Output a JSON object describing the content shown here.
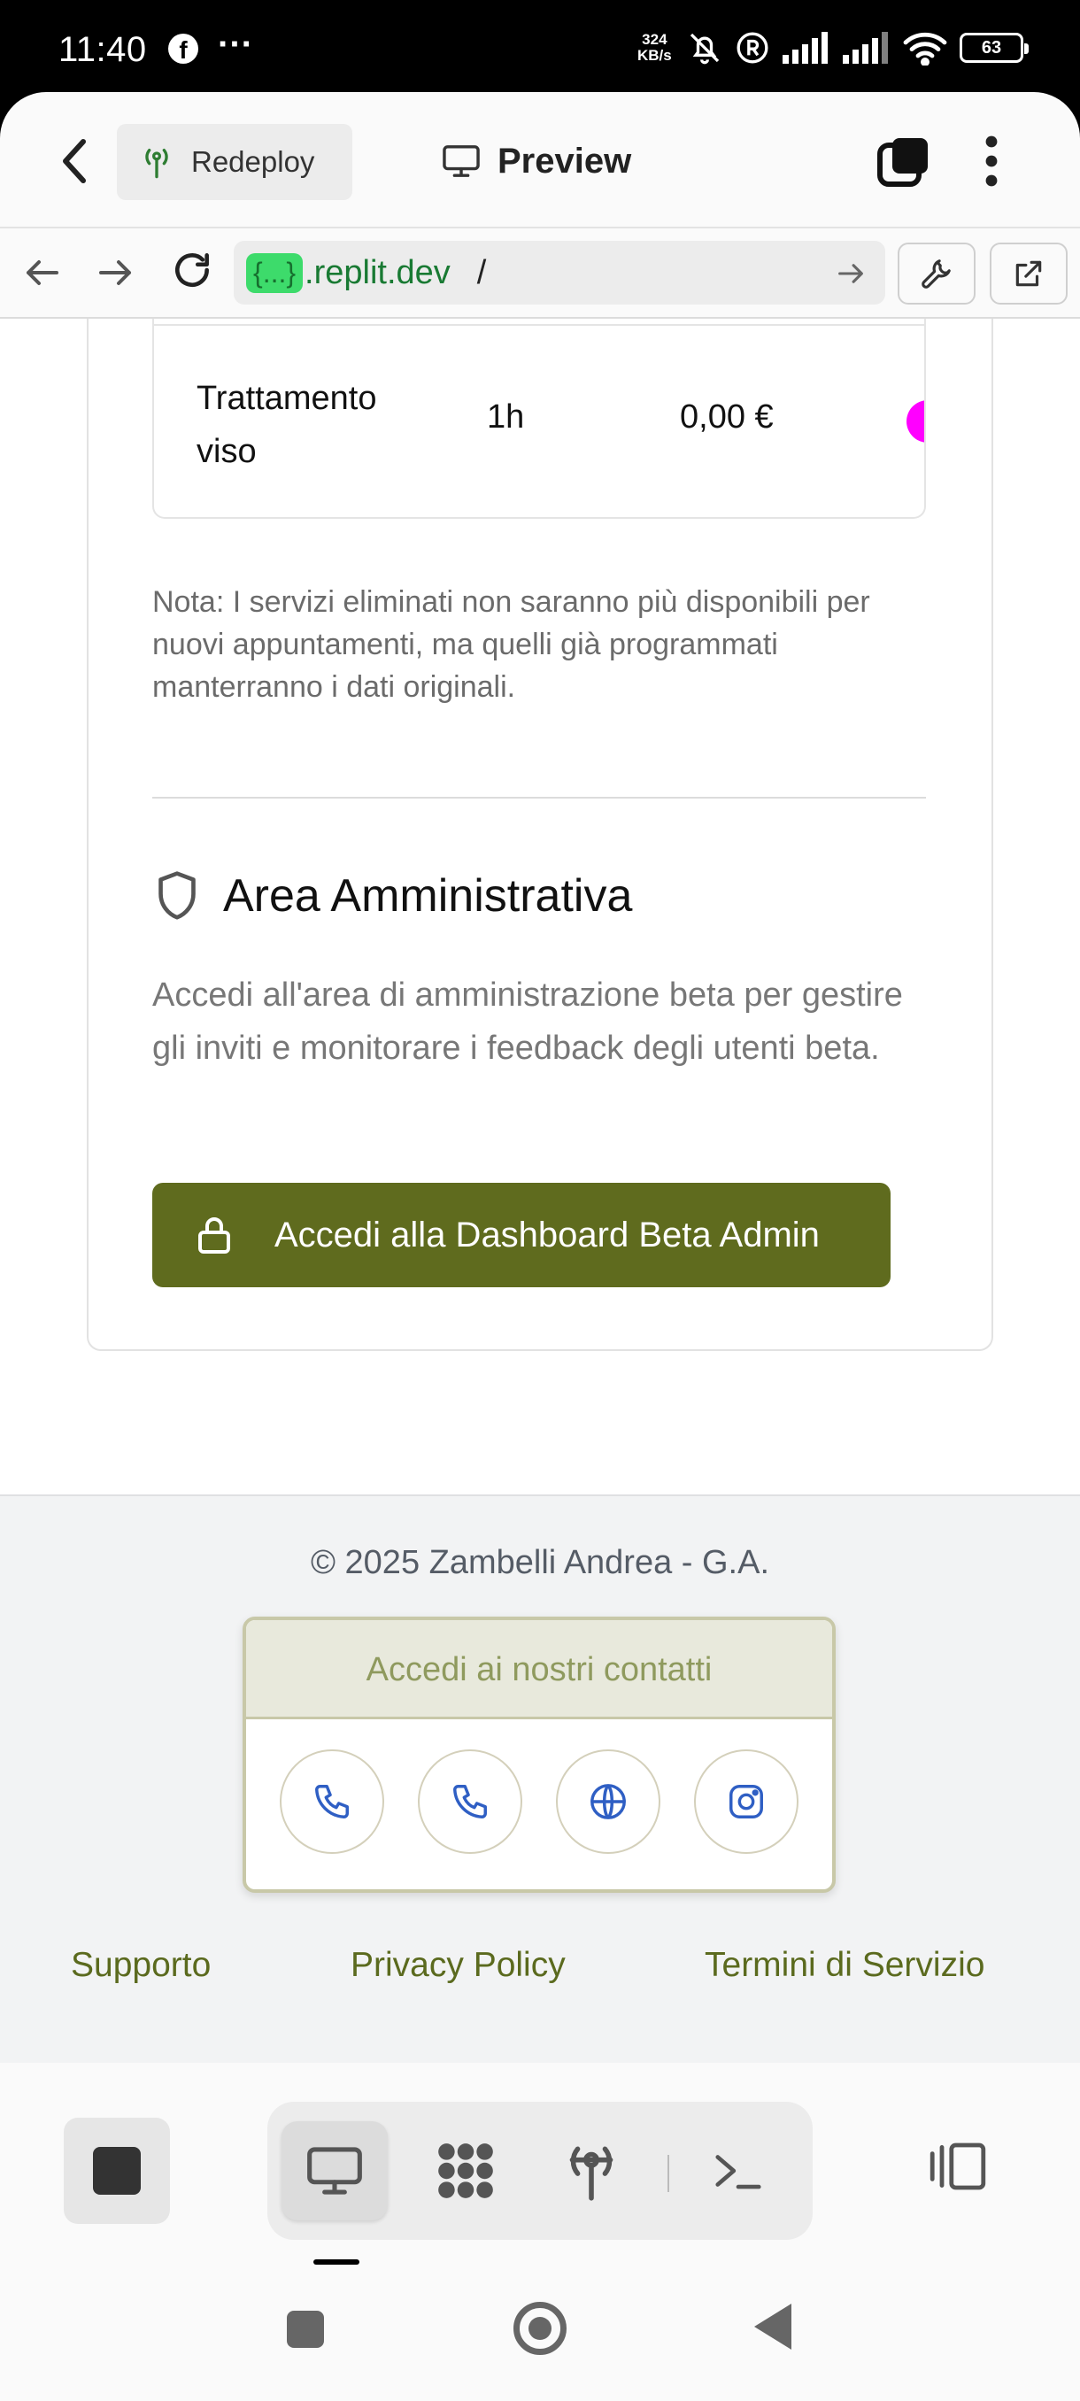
{
  "status_bar": {
    "time": "11:40",
    "facebook_glyph": "f",
    "more": "···",
    "net_speed_value": "324",
    "net_speed_unit": "KB/s",
    "battery": "63"
  },
  "app_header": {
    "redeploy_label": "Redeploy",
    "preview_label": "Preview"
  },
  "url_bar": {
    "chip": "{...}",
    "host": ".replit.dev",
    "path": "/"
  },
  "services_table": {
    "row": {
      "name": "Trattamento viso",
      "duration": "1h",
      "price": "0,00 €",
      "color": "#ff00ff"
    }
  },
  "note": "Nota: I servizi eliminati non saranno più disponibili per nuovi appuntamenti, ma quelli già programmati manterranno i dati originali.",
  "admin": {
    "title": "Area Amministrativa",
    "description": "Accedi all'area di amministrazione beta per gestire gli inviti e monitorare i feedback degli utenti beta.",
    "button_label": "Accedi alla Dashboard Beta Admin"
  },
  "footer": {
    "copyright": "© 2025 Zambelli Andrea - G.A.",
    "contacts_title": "Accedi ai nostri contatti",
    "contact_icons": [
      "phone-icon",
      "phone-icon",
      "globe-icon",
      "instagram-icon"
    ],
    "links": {
      "support": "Supporto",
      "privacy": "Privacy Policy",
      "terms": "Termini di Servizio"
    }
  },
  "colors": {
    "accent": "#5f6b1e",
    "link": "#5b6a1e",
    "contact_icon": "#2f5fc4",
    "url_chip": "#3ddb6b"
  }
}
